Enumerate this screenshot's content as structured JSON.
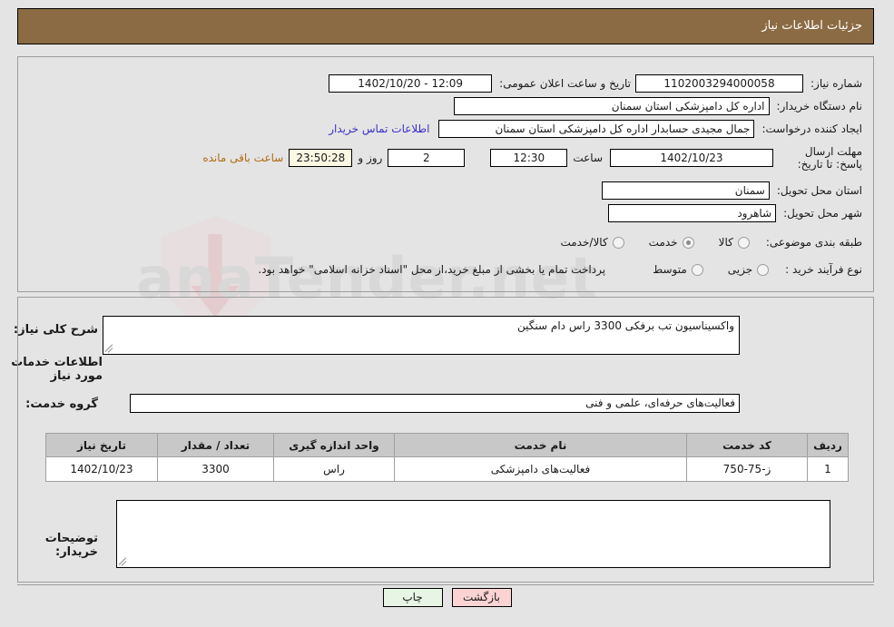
{
  "header": {
    "title": "جزئیات اطلاعات نیاز"
  },
  "form": {
    "need_number_label": "شماره نیاز:",
    "need_number_value": "1102003294000058",
    "announce_label": "تاریخ و ساعت اعلان عمومی:",
    "announce_value": "12:09 - 1402/10/20",
    "buyer_org_label": "نام دستگاه خریدار:",
    "buyer_org_value": "اداره کل دامپزشکی استان سمنان",
    "creator_label": "ایجاد کننده درخواست:",
    "creator_value": "جمال مجیدی حسابدار اداره کل دامپزشکی استان سمنان",
    "contact_link": "اطلاعات تماس خریدار",
    "deadline_label": "مهلت ارسال پاسخ: تا تاریخ:",
    "deadline_date": "1402/10/23",
    "hour_label": "ساعت",
    "deadline_time": "12:30",
    "days_remaining": "2",
    "days_word": "روز و",
    "time_remaining": "23:50:28",
    "remaining_suffix": "ساعت باقی مانده",
    "province_label": "استان محل تحویل:",
    "province_value": "سمنان",
    "city_label": "شهر محل تحویل:",
    "city_value": "شاهرود",
    "category_label": "طبقه بندی موضوعی:",
    "category_options": [
      {
        "label": "کالا",
        "selected": false
      },
      {
        "label": "خدمت",
        "selected": true
      },
      {
        "label": "کالا/خدمت",
        "selected": false
      }
    ],
    "process_label": "نوع فرآیند خرید :",
    "process_options": [
      {
        "label": "جزیی",
        "selected": false
      },
      {
        "label": "متوسط",
        "selected": false
      }
    ],
    "process_note": "پرداخت تمام یا بخشی از مبلغ خرید،از محل \"اسناد خزانه اسلامی\" خواهد بود."
  },
  "need_summary": {
    "label": "شرح کلی نیاز:",
    "value": "واکسیناسیون تب برفکی 3300 راس دام سنگین"
  },
  "services_section": {
    "heading": "اطلاعات خدمات مورد نیاز",
    "group_label": "گروه خدمت:",
    "group_value": "فعالیت‌های حرفه‌ای، علمی و فنی",
    "columns": [
      "ردیف",
      "کد خدمت",
      "نام خدمت",
      "واحد اندازه گیری",
      "تعداد / مقدار",
      "تاریخ نیاز"
    ],
    "rows": [
      {
        "index": "1",
        "code": "ز-75-750",
        "name": "فعالیت‌های دامپزشکی",
        "unit": "راس",
        "quantity": "3300",
        "date": "1402/10/23"
      }
    ]
  },
  "buyer_notes": {
    "label": "توضیحات خریدار:",
    "value": ""
  },
  "buttons": {
    "print": "چاپ",
    "back": "بازگشت"
  },
  "watermark": {
    "text": "anaTender.net"
  }
}
